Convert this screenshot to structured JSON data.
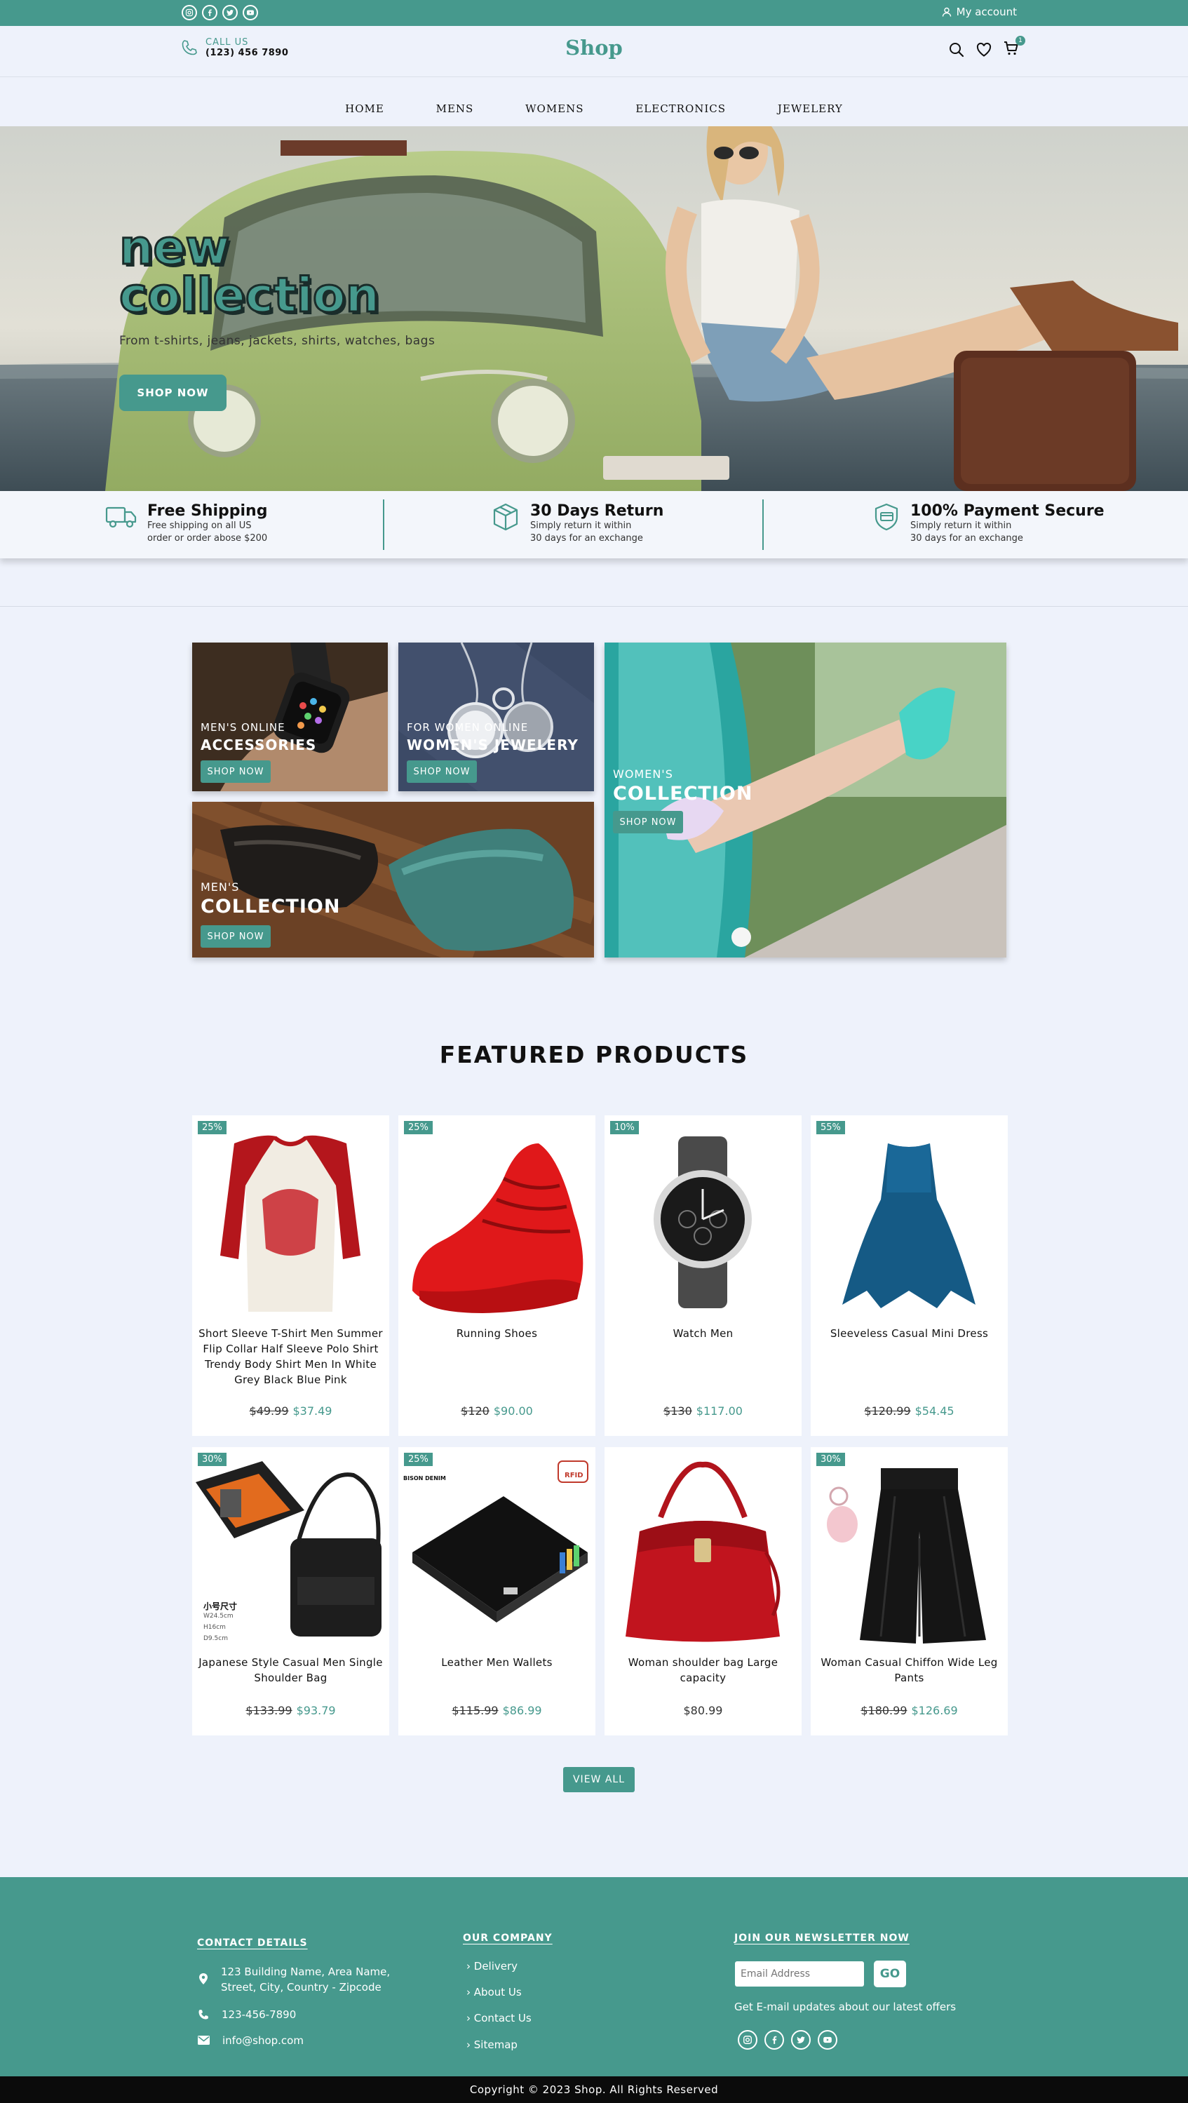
{
  "topbar": {
    "social_icons": [
      "instagram-icon",
      "facebook-icon",
      "twitter-icon",
      "youtube-icon"
    ],
    "account_label": "My account"
  },
  "header": {
    "call_label": "CALL US",
    "phone": "(123) 456 7890",
    "logo": "Shop",
    "cart_count": "1"
  },
  "nav": [
    "HOME",
    "MENS",
    "WOMENS",
    "ELECTRONICS",
    "JEWELERY"
  ],
  "hero": {
    "title_line1": "new",
    "title_line2": "collection",
    "subtitle": "From t-shirts, jeans, jackets, shirts, watches, bags",
    "button": "SHOP NOW"
  },
  "features": [
    {
      "title": "Free Shipping",
      "line1": "Free shipping on all US",
      "line2": "order or order abose $200",
      "icon": "truck-icon"
    },
    {
      "title": "30 Days Return",
      "line1": "Simply return it within",
      "line2": "30 days for an exchange",
      "icon": "box-icon"
    },
    {
      "title": "100% Payment Secure",
      "line1": "Simply return it within",
      "line2": "30 days for an exchange",
      "icon": "secure-payment-icon"
    }
  ],
  "categories": {
    "accessories": {
      "small": "MEN'S ONLINE",
      "big": "ACCESSORIES",
      "button": "SHOP NOW"
    },
    "jewelery": {
      "small": "FOR WOMEN ONLINE",
      "big": "WOMEN'S JEWELERY",
      "button": "SHOP NOW"
    },
    "mens": {
      "small": "MEN'S",
      "big": "COLLECTION",
      "button": "SHOP NOW"
    },
    "womens": {
      "small": "WOMEN'S",
      "big": "COLLECTION",
      "button": "SHOP NOW"
    }
  },
  "featured": {
    "title": "FEATURED PRODUCTS",
    "products": [
      {
        "badge": "25%",
        "name": "Short Sleeve T-Shirt Men Summer Flip Collar Half Sleeve Polo Shirt Trendy Body Shirt Men In White Grey Black Blue Pink",
        "old": "$49.99",
        "price": "$37.49"
      },
      {
        "badge": "25%",
        "name": "Running Shoes",
        "old": "$120",
        "price": "$90.00"
      },
      {
        "badge": "10%",
        "name": "Watch Men",
        "old": "$130",
        "price": "$117.00"
      },
      {
        "badge": "55%",
        "name": "Sleeveless Casual Mini Dress",
        "old": "$120.99",
        "price": "$54.45"
      },
      {
        "badge": "30%",
        "name": "Japanese Style Casual Men Single Shoulder Bag",
        "old": "$133.99",
        "price": "$93.79"
      },
      {
        "badge": "25%",
        "name": "Leather Men Wallets",
        "old": "$115.99",
        "price": "$86.99"
      },
      {
        "badge": "",
        "name": "Woman shoulder bag Large capacity",
        "old": "",
        "price": "$80.99"
      },
      {
        "badge": "30%",
        "name": "Woman Casual Chiffon Wide Leg Pants",
        "old": "$180.99",
        "price": "$126.69"
      }
    ],
    "view_all": "VIEW ALL",
    "bag_size_text": [
      "小号尺寸",
      "W24.5cm",
      "H16cm",
      "D9.5cm"
    ],
    "wallet_brand": "BISON DENIM",
    "wallet_tag": "RFID"
  },
  "footer": {
    "contact_heading": "CONTACT DETAILS",
    "address_line1": "123 Building Name, Area Name,",
    "address_line2": "Street, City, Country - Zipcode",
    "phone": "123-456-7890",
    "email": "info@shop.com",
    "company_heading": "OUR COMPANY",
    "company_links": [
      "Delivery",
      "About Us",
      "Contact Us",
      "Sitemap"
    ],
    "newsletter_heading": "JOIN OUR NEWSLETTER NOW",
    "email_placeholder": "Email Address",
    "go": "GO",
    "newsletter_text": "Get E-mail updates about our latest offers",
    "copyright": "Copyright © 2023 Shop. All Rights Reserved"
  },
  "colors": {
    "accent": "#46998d",
    "background": "#eef2fb",
    "footer_bottom": "#0b0b0b"
  }
}
